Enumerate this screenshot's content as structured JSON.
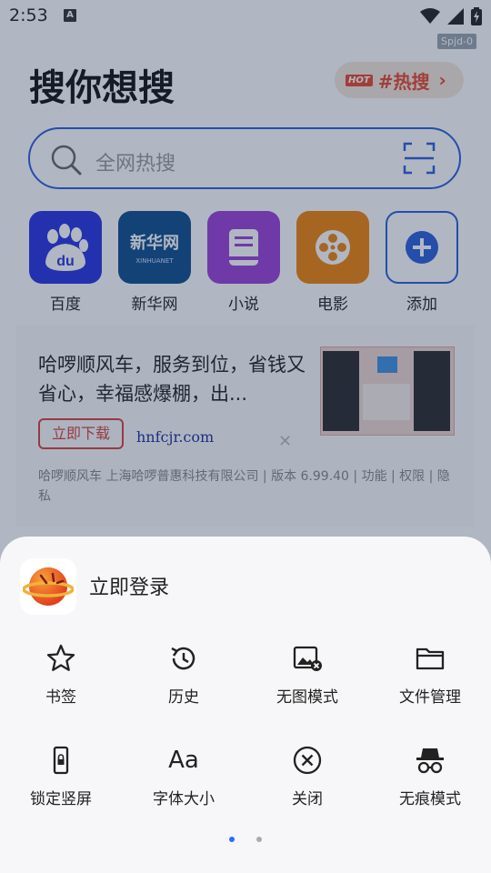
{
  "status_bar": {
    "time": "2:53",
    "a_label": "A",
    "tag": "Spjd-0"
  },
  "header": {
    "title": "搜你想搜",
    "hot_badge": "HOT",
    "hot_label": "#热搜",
    "hot_arrow": "›"
  },
  "search": {
    "placeholder": "全网热搜"
  },
  "apps": [
    {
      "label": "百度",
      "tile_text": "du"
    },
    {
      "label": "新华网",
      "tile_text": "新华网",
      "tile_sub": "XINHUANET"
    },
    {
      "label": "小说"
    },
    {
      "label": "电影"
    },
    {
      "label": "添加"
    }
  ],
  "ad": {
    "title": "哈啰顺风车，服务到位，省钱又省心，幸福感爆棚，出...",
    "button": "立即下载",
    "domain": "hnfcjr.com",
    "close": "✕",
    "meta": "哈啰顺风车 上海哈啰普惠科技有限公司 | 版本 6.99.40 | 功能 | 权限 | 隐私"
  },
  "sheet": {
    "login_label": "立即登录",
    "menu": [
      {
        "label": "书签",
        "icon": "star-icon"
      },
      {
        "label": "历史",
        "icon": "history-icon"
      },
      {
        "label": "无图模式",
        "icon": "no-image-icon"
      },
      {
        "label": "文件管理",
        "icon": "folder-icon"
      },
      {
        "label": "锁定竖屏",
        "icon": "lock-portrait-icon"
      },
      {
        "label": "字体大小",
        "icon": "font-size-icon",
        "glyph": "Aa"
      },
      {
        "label": "关闭",
        "icon": "close-circle-icon"
      },
      {
        "label": "无痕模式",
        "icon": "incognito-icon"
      }
    ],
    "page_index": 0,
    "page_count": 2
  },
  "colors": {
    "accent": "#2a5cdb",
    "hot": "#e8452d",
    "ad_button": "#d94040",
    "overlay": "rgba(30,50,80,0.35)"
  }
}
